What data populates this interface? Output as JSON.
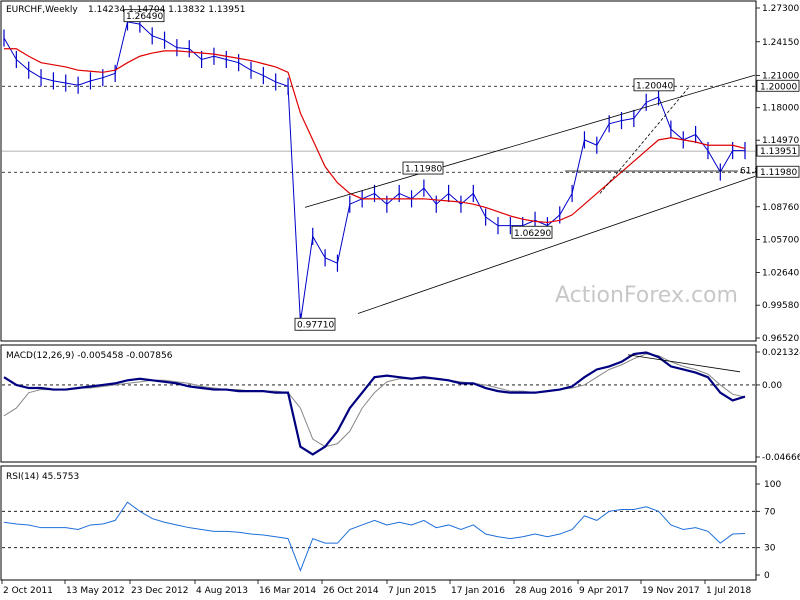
{
  "chart_data": [
    {
      "type": "candlestick",
      "title": "EURCHF,Weekly",
      "ohlc_text": "1.14234 1.14704 1.13832 1.13951",
      "colors": {
        "price": "#0000cc",
        "ma": "#e00000",
        "channel": "#000000"
      },
      "y_ticks": [
        "1.27300",
        "1.24150",
        "1.21000",
        "1.18000",
        "1.14970",
        "1.11980",
        "1.08760",
        "1.05700",
        "1.02640",
        "0.99580",
        "0.96520"
      ],
      "ylim": [
        0.9652,
        1.273
      ],
      "x_ticks": [
        "2 Oct 2011",
        "13 May 2012",
        "23 Dec 2012",
        "4 Aug 2013",
        "16 Mar 2014",
        "26 Oct 2014",
        "7 Jun 2015",
        "17 Jan 2016",
        "28 Aug 2016",
        "9 Apr 2017",
        "19 Nov 2017",
        "1 Jul 2018"
      ],
      "annotations": [
        {
          "text": "1.26490",
          "value": 1.2649
        },
        {
          "text": "1.11980",
          "value": 1.1198
        },
        {
          "text": "1.06290",
          "value": 1.0629
        },
        {
          "text": "1.20040",
          "value": 1.2004
        },
        {
          "text": "0.97710",
          "value": 0.9771
        },
        {
          "text": "61.8",
          "value": 1.121
        }
      ],
      "price_labels": [
        {
          "text": "1.20000",
          "value": 1.2,
          "style": "dashed-level"
        },
        {
          "text": "1.13951",
          "value": 1.13951,
          "style": "current"
        },
        {
          "text": "1.11980",
          "value": 1.1198,
          "style": "dashed-level"
        }
      ],
      "close_series": [
        1.245,
        1.225,
        1.215,
        1.208,
        1.205,
        1.203,
        1.201,
        1.205,
        1.208,
        1.212,
        1.26,
        1.258,
        1.247,
        1.243,
        1.236,
        1.235,
        1.225,
        1.228,
        1.225,
        1.222,
        1.215,
        1.21,
        1.204,
        1.2,
        0.98,
        1.06,
        1.04,
        1.035,
        1.09,
        1.095,
        1.1,
        1.09,
        1.1,
        1.095,
        1.105,
        1.09,
        1.1,
        1.09,
        1.1,
        1.078,
        1.07,
        1.07,
        1.07,
        1.075,
        1.07,
        1.08,
        1.1,
        1.15,
        1.145,
        1.165,
        1.168,
        1.17,
        1.185,
        1.19,
        1.16,
        1.15,
        1.155,
        1.14,
        1.12,
        1.14,
        1.14
      ],
      "ma_series": [
        1.235,
        1.235,
        1.228,
        1.222,
        1.22,
        1.218,
        1.215,
        1.214,
        1.213,
        1.215,
        1.222,
        1.228,
        1.231,
        1.233,
        1.233,
        1.232,
        1.231,
        1.23,
        1.228,
        1.226,
        1.224,
        1.221,
        1.218,
        1.213,
        1.175,
        1.15,
        1.125,
        1.11,
        1.1,
        1.095,
        1.095,
        1.095,
        1.095,
        1.095,
        1.095,
        1.094,
        1.093,
        1.092,
        1.09,
        1.087,
        1.083,
        1.079,
        1.076,
        1.074,
        1.073,
        1.075,
        1.08,
        1.09,
        1.1,
        1.11,
        1.12,
        1.13,
        1.14,
        1.15,
        1.152,
        1.15,
        1.148,
        1.145,
        1.145,
        1.145,
        1.142
      ],
      "channel": {
        "upper": [
          [
            1.05,
            1.087
          ],
          [
            1.221,
            1.21
          ]
        ],
        "lower": [
          [
            0.99,
            0.985
          ],
          [
            1.112,
            1.12
          ]
        ],
        "level_1_20": 1.2,
        "level_1_1198": 1.1198,
        "current": 1.13951
      }
    },
    {
      "type": "line",
      "title": "MACD(12,26,9) -0.005458 -0.007856",
      "y_ticks": [
        "0.021324",
        "0.00",
        "-0.046663"
      ],
      "ylim": [
        -0.046663,
        0.021324
      ],
      "macd": [
        0.005,
        0.0,
        -0.002,
        -0.002,
        -0.003,
        -0.003,
        -0.002,
        -0.001,
        0.0,
        0.001,
        0.003,
        0.004,
        0.003,
        0.002,
        0.001,
        -0.001,
        -0.002,
        -0.003,
        -0.003,
        -0.004,
        -0.004,
        -0.004,
        -0.005,
        -0.005,
        -0.04,
        -0.045,
        -0.04,
        -0.03,
        -0.015,
        -0.005,
        0.005,
        0.006,
        0.005,
        0.004,
        0.005,
        0.004,
        0.003,
        0.001,
        0.001,
        -0.002,
        -0.004,
        -0.005,
        -0.005,
        -0.005,
        -0.004,
        -0.003,
        -0.001,
        0.005,
        0.01,
        0.012,
        0.015,
        0.02,
        0.021,
        0.018,
        0.012,
        0.01,
        0.008,
        0.005,
        -0.005,
        -0.01,
        -0.0075
      ],
      "signal": [
        -0.02,
        -0.015,
        -0.005,
        -0.003,
        -0.003,
        -0.003,
        -0.002,
        -0.002,
        -0.001,
        0.0,
        0.001,
        0.002,
        0.003,
        0.003,
        0.002,
        0.001,
        -0.001,
        -0.002,
        -0.003,
        -0.003,
        -0.004,
        -0.004,
        -0.004,
        -0.005,
        -0.015,
        -0.035,
        -0.04,
        -0.038,
        -0.03,
        -0.015,
        -0.005,
        0.002,
        0.004,
        0.004,
        0.004,
        0.004,
        0.003,
        0.002,
        0.001,
        0.0,
        -0.002,
        -0.004,
        -0.004,
        -0.005,
        -0.004,
        -0.003,
        -0.002,
        0.0,
        0.005,
        0.01,
        0.013,
        0.017,
        0.02,
        0.019,
        0.015,
        0.012,
        0.01,
        0.007,
        0.0,
        -0.006,
        -0.0079
      ]
    },
    {
      "type": "line",
      "title": "RSI(14) 45.5753",
      "y_ticks": [
        "100",
        "70",
        "30",
        "0"
      ],
      "ylim": [
        0,
        100
      ],
      "rsi": [
        58,
        56,
        55,
        52,
        52,
        52,
        50,
        55,
        56,
        60,
        80,
        70,
        62,
        58,
        55,
        52,
        50,
        48,
        48,
        47,
        45,
        44,
        42,
        40,
        5,
        40,
        35,
        35,
        50,
        55,
        60,
        55,
        58,
        55,
        60,
        52,
        55,
        50,
        55,
        45,
        42,
        40,
        42,
        45,
        42,
        45,
        50,
        65,
        60,
        70,
        72,
        72,
        75,
        70,
        55,
        50,
        52,
        48,
        35,
        45,
        45.5753
      ]
    }
  ],
  "watermark": "ActionForex.com"
}
